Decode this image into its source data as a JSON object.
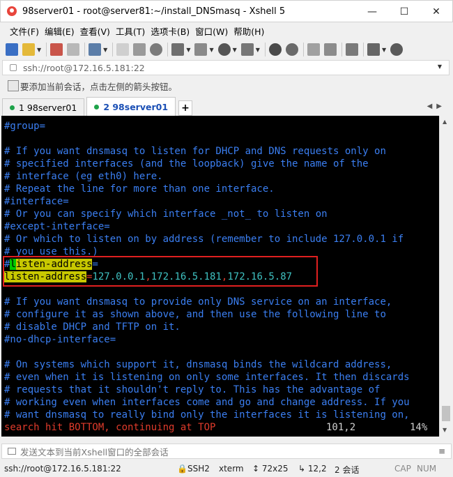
{
  "window": {
    "title": "98server01 - root@server81:~/install_DNSmasq - Xshell 5",
    "minimize": "—",
    "maximize": "☐",
    "close": "✕"
  },
  "menu": [
    "文件(F)",
    "编辑(E)",
    "查看(V)",
    "工具(T)",
    "选项卡(B)",
    "窗口(W)",
    "帮助(H)"
  ],
  "address": {
    "value": "ssh://root@172.16.5.181:22",
    "dropdown": "▼"
  },
  "hint": "要添加当前会话，点击左侧的箭头按钮。",
  "tabs": [
    {
      "label": "1 98server01",
      "active": false
    },
    {
      "label": "2 98server01",
      "active": true
    }
  ],
  "tab_add": "+",
  "tab_nav": "◀▶",
  "terminal": {
    "lines": [
      "#group=",
      "",
      "# If you want dnsmasq to listen for DHCP and DNS requests only on",
      "# specified interfaces (and the loopback) give the name of the",
      "# interface (eg eth0) here.",
      "# Repeat the line for more than one interface.",
      "#interface=",
      "# Or you can specify which interface _not_ to listen on",
      "#except-interface=",
      "# Or which to listen on by address (remember to include 127.0.0.1 if",
      "# you use this.)"
    ],
    "line_hash_listen": {
      "hash": "#",
      "cursor_char": "l",
      "rest": "isten-address",
      "eq": "="
    },
    "line_listen": {
      "key": "listen-address",
      "eq": "=",
      "v1": "127.0.0.1",
      "c1": ",",
      "v2": "172.16.5.181",
      "c2": ",",
      "v3": "172.16.5.87"
    },
    "lines_after": [
      "",
      "# If you want dnsmasq to provide only DNS service on an interface,",
      "# configure it as shown above, and then use the following line to",
      "# disable DHCP and TFTP on it.",
      "#no-dhcp-interface=",
      "",
      "# On systems which support it, dnsmasq binds the wildcard address,",
      "# even when it is listening on only some interfaces. It then discards",
      "# requests that it shouldn't reply to. This has the advantage of",
      "# working even when interfaces come and go and change address. If you",
      "# want dnsmasq to really bind only the interfaces it is listening on,"
    ],
    "status_message": "search hit BOTTOM, continuing at TOP",
    "cursor_pos": "101,2",
    "percent": "14%"
  },
  "input_bar": {
    "placeholder": "发送文本到当前Xshell窗口的全部会话",
    "menu": "≡"
  },
  "statusbar": {
    "connection": "ssh://root@172.16.5.181:22",
    "protocol": "SSH2",
    "term": "xterm",
    "size": "72x25",
    "position": "12,2",
    "sessions": "2 会话",
    "cap": "CAP",
    "num": "NUM"
  },
  "colors": {
    "terminal_bg": "#000000",
    "comment_blue": "#3b7ff2",
    "highlight_yellow": "#c8c800",
    "cursor_green": "#00c800",
    "value_cyan": "#3fc2c2",
    "status_red": "#e03b2b",
    "box_red": "#e02020"
  }
}
